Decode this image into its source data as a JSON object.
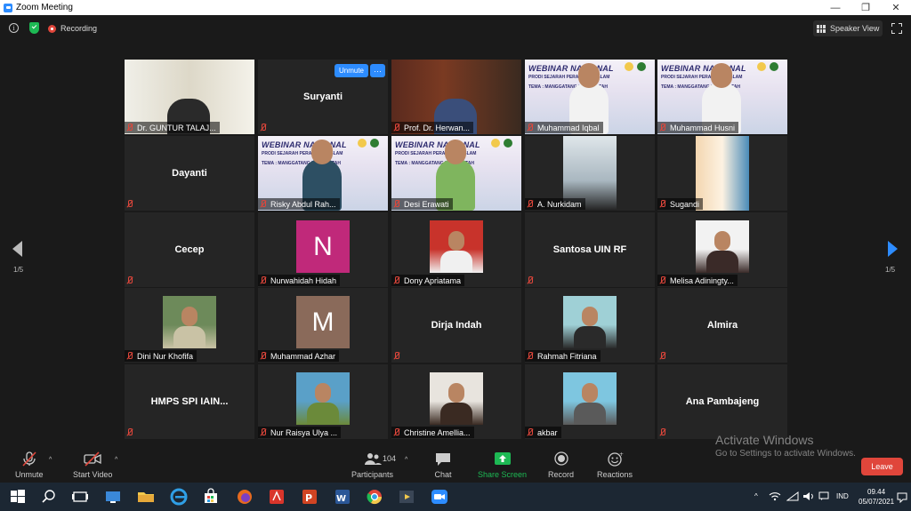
{
  "window": {
    "title": "Zoom Meeting",
    "minimize": "—",
    "restore": "❐",
    "close": "✕"
  },
  "topbar": {
    "info_glyph": "i",
    "recording_label": "Recording",
    "speaker_view_label": "Speaker View"
  },
  "tiles": [
    {
      "name": "Dr. GUNTUR TALAJ...",
      "type": "video",
      "active": true
    },
    {
      "name": "Suryanti",
      "type": "name"
    },
    {
      "name": "Prof. Dr. Herwan...",
      "type": "video"
    },
    {
      "name": "Muhammad Iqbal",
      "type": "webinar"
    },
    {
      "name": "Muhammad Husni",
      "type": "webinar"
    },
    {
      "name": "Dayanti",
      "type": "name"
    },
    {
      "name": "Risky Abdul Rah...",
      "type": "webinar"
    },
    {
      "name": "Desi Erawati",
      "type": "webinar"
    },
    {
      "name": "A. Nurkidam",
      "type": "video"
    },
    {
      "name": "Sugandi",
      "type": "video"
    },
    {
      "name": "Cecep",
      "type": "name"
    },
    {
      "name": "Nurwahidah Hidah",
      "type": "letter",
      "letter": "N",
      "color": "#c0297a"
    },
    {
      "name": "Dony Apriatama",
      "type": "photo"
    },
    {
      "name": "Santosa UIN RF",
      "type": "name"
    },
    {
      "name": "Melisa Adiningty...",
      "type": "photo"
    },
    {
      "name": "Dini Nur Khofifa",
      "type": "photo"
    },
    {
      "name": "Muhammad Azhar",
      "type": "letter",
      "letter": "M",
      "color": "#8a6a5a"
    },
    {
      "name": "Dirja Indah",
      "type": "name"
    },
    {
      "name": "Rahmah Fitriana",
      "type": "photo"
    },
    {
      "name": "Almira",
      "type": "name"
    },
    {
      "name": "HMPS SPI  IAIN...",
      "type": "name"
    },
    {
      "name": "Nur Raisya Ulya ...",
      "type": "photo"
    },
    {
      "name": "Christine Amellia...",
      "type": "photo"
    },
    {
      "name": "akbar",
      "type": "photo"
    },
    {
      "name": "Ana Pambajeng",
      "type": "name"
    }
  ],
  "webinar_banner": {
    "title": "WEBINAR NASIONAL",
    "prodi": "PRODI SEJARAH PERADABAN ISLAM",
    "tema": "TEMA : MANGGATANG BUDAYA ITAH"
  },
  "tile_controls": {
    "unmute": "Unmute",
    "more": "···"
  },
  "paging": {
    "left": "1/5",
    "right": "1/5"
  },
  "toolbar": {
    "unmute": "Unmute",
    "start_video": "Start Video",
    "participants": "Participants",
    "participants_count": "104",
    "chat": "Chat",
    "share_screen": "Share Screen",
    "record": "Record",
    "reactions": "Reactions",
    "leave": "Leave",
    "caret": "^"
  },
  "watermark": {
    "line1": "Activate Windows",
    "line2": "Go to Settings to activate Windows."
  },
  "taskbar": {
    "lang": "IND",
    "time": "09.44",
    "date": "05/07/2021"
  },
  "colors": {
    "accent": "#2d8cff",
    "active_border": "#c9e33e",
    "danger": "#e0463b",
    "share": "#1db954"
  }
}
